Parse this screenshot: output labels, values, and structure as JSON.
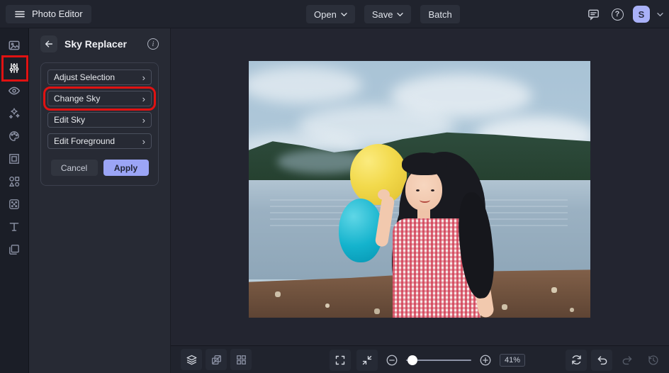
{
  "topbar": {
    "app_title": "Photo Editor",
    "open_label": "Open",
    "save_label": "Save",
    "batch_label": "Batch",
    "avatar_initial": "S"
  },
  "rail": {
    "items": [
      {
        "icon": "image-icon"
      },
      {
        "icon": "adjust-sliders-icon",
        "active": true,
        "annotated": true
      },
      {
        "icon": "touchup-eye-icon"
      },
      {
        "icon": "effects-sparkle-icon"
      },
      {
        "icon": "artsy-palette-icon"
      },
      {
        "icon": "frames-icon"
      },
      {
        "icon": "graphics-shapes-icon"
      },
      {
        "icon": "overlays-texture-icon"
      },
      {
        "icon": "text-icon"
      },
      {
        "icon": "layers-copies-icon"
      }
    ]
  },
  "panel": {
    "title": "Sky Replacer",
    "rows": [
      {
        "label": "Adjust Selection"
      },
      {
        "label": "Change Sky",
        "annotated": true
      },
      {
        "label": "Edit Sky"
      },
      {
        "label": "Edit Foreground"
      }
    ],
    "cancel_label": "Cancel",
    "apply_label": "Apply"
  },
  "bottombar": {
    "zoom_value": "41%"
  },
  "glyphs": {
    "row_chevron": "›",
    "help_mark": "?",
    "info_mark": "i"
  },
  "colors": {
    "annotation_red": "#e01212",
    "accent_apply": "#9ba5f6",
    "avatar_bg": "#a9b1f8",
    "topbar_bg": "#20232d",
    "panel_bg": "#272a34",
    "canvas_bg": "#232530",
    "balloon_yellow": "#f2d94b",
    "balloon_cyan": "#14b3cd"
  }
}
